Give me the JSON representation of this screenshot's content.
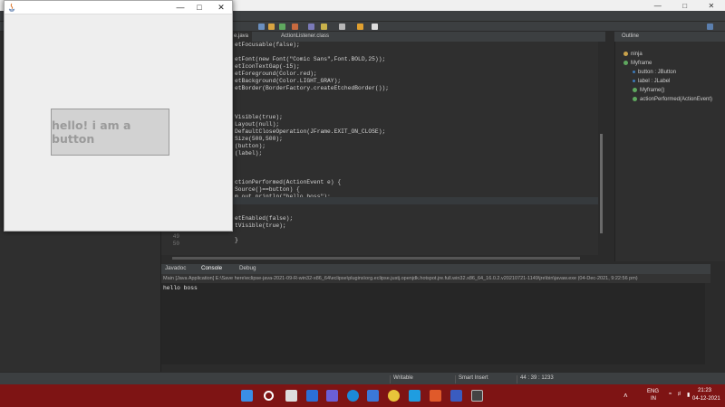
{
  "editor": {
    "tabs": [
      "e.java",
      "ActionListener.class"
    ],
    "code_lines": [
      {
        "text": "etFocusable(false);"
      },
      {
        "text": ""
      },
      {
        "text": "etFont(new Font(\"Comic Sans\",Font.BOLD,25));"
      },
      {
        "text": "etIconTextGap(-15);"
      },
      {
        "text": "etForeground(Color.red);"
      },
      {
        "text": "etBackground(Color.LIGHT_GRAY);"
      },
      {
        "text": "etBorder(BorderFactory.createEtchedBorder());"
      },
      {
        "text": ""
      },
      {
        "text": ""
      },
      {
        "text": ""
      },
      {
        "text": "Visible(true);"
      },
      {
        "text": "Layout(null);"
      },
      {
        "text": "DefaultCloseOperation(JFrame.EXIT_ON_CLOSE);"
      },
      {
        "text": "Size(500,500);"
      },
      {
        "text": "(button);"
      },
      {
        "text": "(label);"
      },
      {
        "text": ""
      },
      {
        "text": ""
      },
      {
        "text": ""
      },
      {
        "text": "ctionPerformed(ActionEvent e) {"
      },
      {
        "text": "Source()==button) {"
      },
      {
        "text": "m.out.println(\"hello boss\");"
      },
      {
        "text": ""
      },
      {
        "text": ""
      },
      {
        "text": "etEnabled(false);"
      },
      {
        "text": "tVisible(true);"
      },
      {
        "text": ""
      },
      {
        "text": "}"
      }
    ],
    "line_numbers": [
      "49",
      "50"
    ]
  },
  "outline": {
    "title": "Outline",
    "items": [
      {
        "label": "ninja"
      },
      {
        "label": "Myframe"
      },
      {
        "label": "button : JButton"
      },
      {
        "label": "label : JLabel"
      },
      {
        "label": "Myframe()"
      },
      {
        "label": "actionPerformed(ActionEvent)"
      }
    ]
  },
  "console": {
    "tabs": [
      "Javadoc",
      "Console",
      "Debug"
    ],
    "path": "Main [Java Application] E:\\Save here\\eclipse-java-2021-09-R-win32-x86_64\\eclipse\\plugins\\org.eclipse.justj.openjdk.hotspot.jre.full.win32.x86_64_16.0.2.v20210721-1149\\jre\\bin\\javaw.exe  (04-Dec-2021, 9:22:56 pm)",
    "output": "hello boss"
  },
  "status": {
    "mode": "Writable",
    "insert": "Smart Insert",
    "position": "44 : 39 : 1233"
  },
  "swing": {
    "button_label": "hello! i am a button"
  },
  "tray": {
    "lang": "ENG",
    "region": "IN",
    "time": "21:23",
    "date": "04-12-2021"
  },
  "colors": {
    "taskbar": "#7e1414",
    "editor_bg": "#2f2f2f",
    "button_text": "#9a9a9a"
  }
}
